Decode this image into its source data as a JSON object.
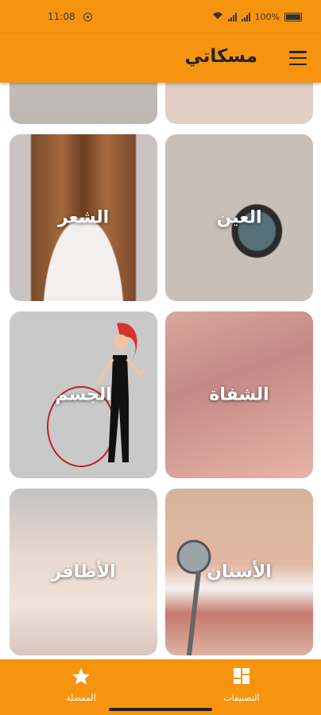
{
  "status_bar": {
    "time": "11:08",
    "battery": "100%"
  },
  "app_bar": {
    "title": "مسكاتي"
  },
  "categories": [
    {
      "label": "العين"
    },
    {
      "label": "الشعر"
    },
    {
      "label": "الشفاة"
    },
    {
      "label": "الجسم"
    },
    {
      "label": "الأسنان"
    },
    {
      "label": "الأظافر"
    }
  ],
  "bottom_nav": {
    "categories_label": "التصنيفات",
    "favorites_label": "المفضلة"
  },
  "colors": {
    "accent": "#f7940f"
  }
}
